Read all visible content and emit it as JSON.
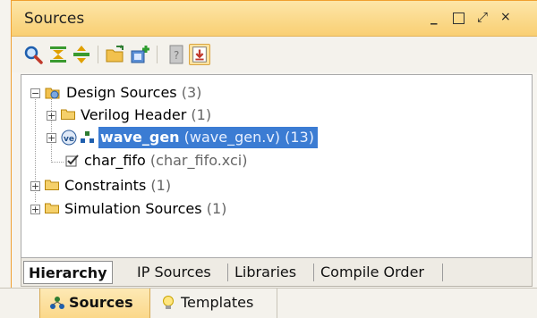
{
  "window": {
    "title": "Sources",
    "controls": {
      "minimize": "_",
      "maximize": "□",
      "float": "⤢",
      "close": "×"
    }
  },
  "toolbar": {
    "items": [
      {
        "icon": "search-icon"
      },
      {
        "icon": "collapse-all-icon"
      },
      {
        "icon": "expand-all-icon"
      },
      {
        "icon": "open-folder-icon"
      },
      {
        "icon": "add-sources-icon"
      },
      {
        "icon": "help-icon"
      },
      {
        "icon": "auto-update-icon",
        "active": true
      }
    ]
  },
  "tree": {
    "design_sources": {
      "label": "Design Sources",
      "count": "(3)"
    },
    "verilog_header": {
      "label": "Verilog Header",
      "count": "(1)"
    },
    "wave_gen": {
      "label": "wave_gen",
      "detail": "(wave_gen.v) (13)"
    },
    "char_fifo": {
      "label": "char_fifo",
      "detail": "(char_fifo.xci)"
    },
    "constraints": {
      "label": "Constraints",
      "count": "(1)"
    },
    "simulation_sources": {
      "label": "Simulation Sources",
      "count": "(1)"
    }
  },
  "view_tabs": [
    {
      "label": "Hierarchy",
      "active": true
    },
    {
      "label": "IP Sources"
    },
    {
      "label": "Libraries"
    },
    {
      "label": "Compile Order"
    }
  ],
  "bottom_tabs": [
    {
      "label": "Sources",
      "active": true
    },
    {
      "label": "Templates"
    }
  ],
  "colors": {
    "title_bar": "#f9cf73",
    "selection": "#3b7cd3",
    "accent_border": "#f0a030"
  }
}
